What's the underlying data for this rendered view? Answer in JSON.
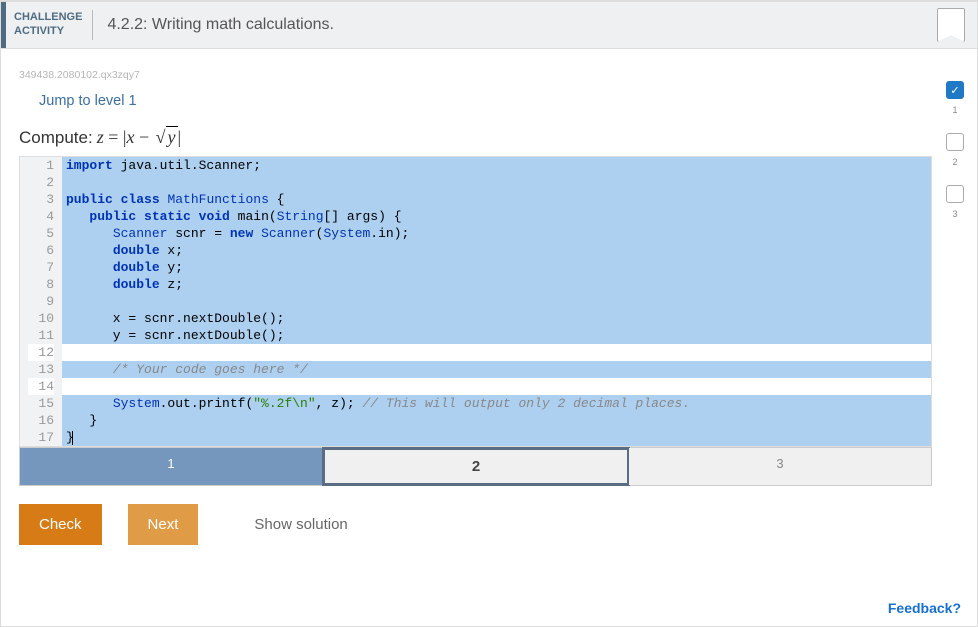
{
  "header": {
    "label_line1": "CHALLENGE",
    "label_line2": "ACTIVITY",
    "title": "4.2.2: Writing math calculations."
  },
  "code_id": "349438.2080102.qx3zqy7",
  "jump_link": "Jump to level 1",
  "compute_prefix": "Compute: ",
  "formula": {
    "z": "z",
    "eq": " = ",
    "abs_open": "|",
    "x": "x",
    "minus": " − ",
    "y": "y",
    "abs_close": "|"
  },
  "code": {
    "lines": [
      [
        {
          "t": "kw",
          "v": "import"
        },
        {
          "t": "",
          "v": " java.util.Scanner;"
        }
      ],
      [
        {
          "t": "",
          "v": ""
        }
      ],
      [
        {
          "t": "kw",
          "v": "public"
        },
        {
          "t": "",
          "v": " "
        },
        {
          "t": "kw",
          "v": "class"
        },
        {
          "t": "",
          "v": " "
        },
        {
          "t": "cls",
          "v": "MathFunctions"
        },
        {
          "t": "",
          "v": " {"
        }
      ],
      [
        {
          "t": "",
          "v": "   "
        },
        {
          "t": "kw",
          "v": "public"
        },
        {
          "t": "",
          "v": " "
        },
        {
          "t": "kw",
          "v": "static"
        },
        {
          "t": "",
          "v": " "
        },
        {
          "t": "kw",
          "v": "void"
        },
        {
          "t": "",
          "v": " main("
        },
        {
          "t": "cls",
          "v": "String"
        },
        {
          "t": "",
          "v": "[] args) {"
        }
      ],
      [
        {
          "t": "",
          "v": "      "
        },
        {
          "t": "cls",
          "v": "Scanner"
        },
        {
          "t": "",
          "v": " scnr = "
        },
        {
          "t": "kw",
          "v": "new"
        },
        {
          "t": "",
          "v": " "
        },
        {
          "t": "cls",
          "v": "Scanner"
        },
        {
          "t": "",
          "v": "("
        },
        {
          "t": "cls",
          "v": "System"
        },
        {
          "t": "",
          "v": ".in);"
        }
      ],
      [
        {
          "t": "",
          "v": "      "
        },
        {
          "t": "kw",
          "v": "double"
        },
        {
          "t": "",
          "v": " x;"
        }
      ],
      [
        {
          "t": "",
          "v": "      "
        },
        {
          "t": "kw",
          "v": "double"
        },
        {
          "t": "",
          "v": " y;"
        }
      ],
      [
        {
          "t": "",
          "v": "      "
        },
        {
          "t": "kw",
          "v": "double"
        },
        {
          "t": "",
          "v": " z;"
        }
      ],
      [
        {
          "t": "",
          "v": ""
        }
      ],
      [
        {
          "t": "",
          "v": "      x = scnr.nextDouble();"
        }
      ],
      [
        {
          "t": "",
          "v": "      y = scnr.nextDouble();"
        }
      ],
      [
        {
          "t": "",
          "v": ""
        }
      ],
      [
        {
          "t": "",
          "v": "      "
        },
        {
          "t": "cmt",
          "v": "/* Your code goes here */"
        }
      ],
      [
        {
          "t": "",
          "v": ""
        }
      ],
      [
        {
          "t": "",
          "v": "      "
        },
        {
          "t": "cls",
          "v": "System"
        },
        {
          "t": "",
          "v": ".out.printf("
        },
        {
          "t": "str",
          "v": "\"%.2f\\n\""
        },
        {
          "t": "",
          "v": ", z); "
        },
        {
          "t": "cmt",
          "v": "// This will output only 2 decimal places."
        }
      ],
      [
        {
          "t": "",
          "v": "   }"
        }
      ],
      [
        {
          "t": "",
          "v": "}"
        }
      ]
    ],
    "active_lines": [
      12,
      14
    ]
  },
  "tabs": [
    {
      "label": "1",
      "state": "done"
    },
    {
      "label": "2",
      "state": "current"
    },
    {
      "label": "3",
      "state": ""
    }
  ],
  "buttons": {
    "check": "Check",
    "next": "Next",
    "show_solution": "Show solution"
  },
  "levels": [
    {
      "num": "1",
      "done": true
    },
    {
      "num": "2",
      "done": false
    },
    {
      "num": "3",
      "done": false
    }
  ],
  "feedback": "Feedback?"
}
